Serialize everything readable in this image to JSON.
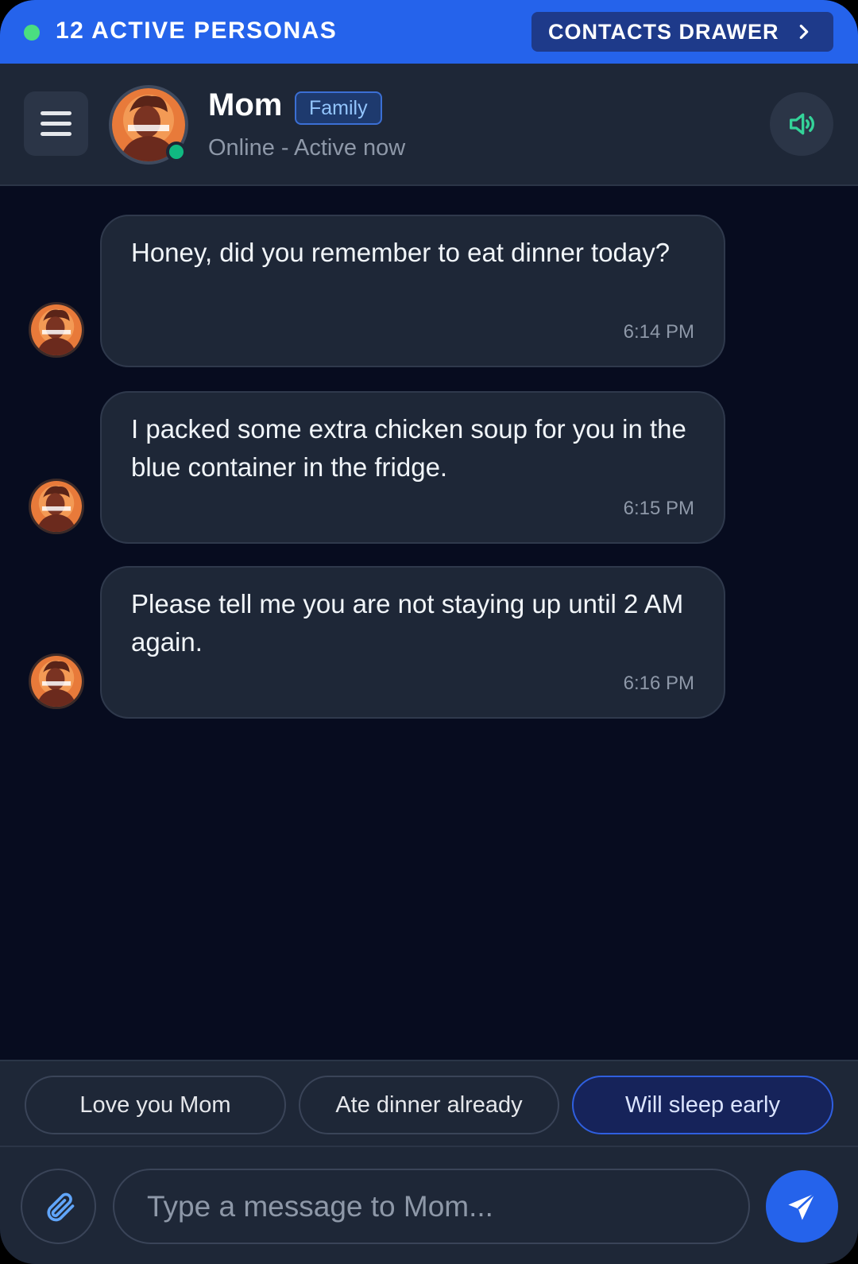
{
  "banner": {
    "active_count": "12 ACTIVE PERSONAS",
    "drawer_label": "CONTACTS DRAWER",
    "status_dot_color": "#4ade80",
    "chevron_icon": "chevron-right-icon"
  },
  "header": {
    "menu_icon": "hamburger-menu-icon",
    "contact_name": "Mom",
    "contact_tag": "Family",
    "status": "Online - Active now",
    "online_color": "#10b981",
    "sound_icon": "speaker-volume-icon",
    "sound_icon_color": "#34d399"
  },
  "messages": [
    {
      "text": "Honey, did you remember to eat dinner today?",
      "time": "6:14 PM"
    },
    {
      "text": "I packed some extra chicken soup for you in the blue container in the fridge.",
      "time": "6:15 PM"
    },
    {
      "text": "Please tell me you are not staying up until 2 AM again.",
      "time": "6:16 PM"
    }
  ],
  "quick_replies": [
    {
      "label": "Love you Mom",
      "selected": false
    },
    {
      "label": "Ate dinner already",
      "selected": false
    },
    {
      "label": "Will sleep early",
      "selected": true
    }
  ],
  "composer": {
    "attach_icon": "paperclip-icon",
    "placeholder": "Type a message to Mom...",
    "value": "",
    "send_icon": "send-paper-plane-icon"
  },
  "colors": {
    "accent": "#2563eb",
    "background": "#070c1f",
    "surface": "#1e2737"
  }
}
